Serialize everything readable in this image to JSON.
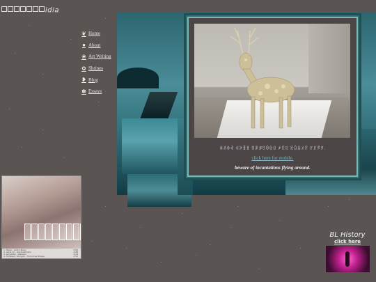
{
  "site": {
    "logo_text": "idia"
  },
  "nav": {
    "items": [
      {
        "label": "Home",
        "icon": "leaf-icon"
      },
      {
        "label": "About",
        "icon": "apple-icon"
      },
      {
        "label": "Art Writing",
        "icon": "cherry-icon"
      },
      {
        "label": "Shrines",
        "icon": "flower-icon"
      },
      {
        "label": "Blog",
        "icon": "butterfly-icon"
      },
      {
        "label": "Essays",
        "icon": "candy-icon"
      }
    ]
  },
  "feature": {
    "caption_glyphs": "ꆜꆝꆞꆟ ꆠꆡꆢꆣ ꆤꆥꆦꆧꆨꆩꆪ ꆫꆬꆭ ꆮꆯꆰꆱꆲ ꆳꆴꆵꆶ.",
    "mobile_link": "click here for mobile.",
    "warning": "beware of incantations flying around."
  },
  "player": {
    "tracks": [
      {
        "title": "1. Taare - Anton Brain",
        "dur": "3:56"
      },
      {
        "title": "2. aqua.mi - stardustmaxx",
        "dur": "4:48"
      },
      {
        "title": "3. sunsetter - Mansen",
        "dur": "3:14"
      },
      {
        "title": "4. Professor Shingan - Tomorrow Shape",
        "dur": "3:52"
      }
    ],
    "time": "0:00 / 3:56"
  },
  "bl_history": {
    "title": "BL History",
    "link": "click here"
  },
  "colors": {
    "background": "#5a5552",
    "frame_border": "#2f6f72",
    "link_teal": "#7fb0c0"
  }
}
